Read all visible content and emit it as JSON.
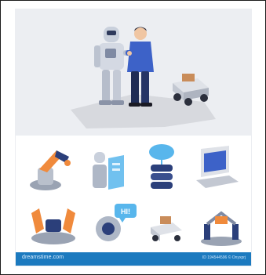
{
  "footer": {
    "brand": "dreamstime.com",
    "stock_id": "ID 194544596 © Onyxprj"
  },
  "speech_bubble": {
    "text": "HI!"
  },
  "colors": {
    "hero_bg": "#eceef2",
    "footer_bar": "#1c7abf",
    "robot_orange": "#f08a3c",
    "navy": "#2b3f7a",
    "shirt_blue": "#3d62c8",
    "cloud_blue": "#58b6ec"
  },
  "icons": [
    "humanoid-robot-icon",
    "businessman-icon",
    "rover-robot-icon",
    "industrial-arm-icon",
    "robot-hologram-icon",
    "cloud-server-icon",
    "laptop-icon",
    "twin-arms-icon",
    "chat-robot-icon",
    "delivery-rover-icon",
    "gripper-arms-icon"
  ]
}
